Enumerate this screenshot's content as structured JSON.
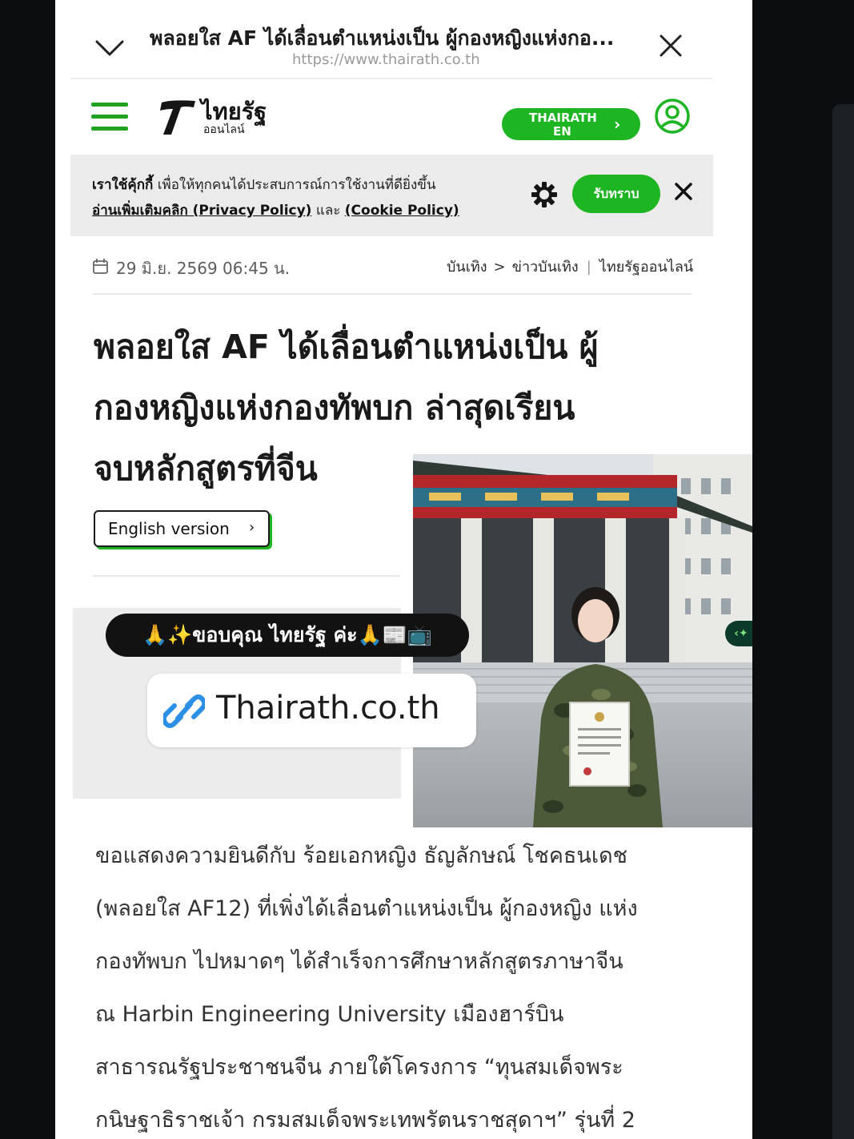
{
  "browser": {
    "tab_title": "พลอยใส AF ได้เลื่อนตำแหน่งเป็น ผู้กองหญิงแห่งกอ...",
    "url": "https://www.thairath.co.th"
  },
  "site_header": {
    "logo_name": "ไทยรัฐ",
    "logo_sub": "ออนไลน์",
    "en_button_line1": "THAIRATH",
    "en_button_line2": "EN",
    "en_button_arrow": "›"
  },
  "cookie_banner": {
    "bold_text": "เราใช้คุ้กกี้",
    "text": " เพื่อให้ทุกคนได้ประสบการณ์การใช้งานที่ดียิ่งขึ้น",
    "more_link": "อ่านเพิ่มเติมคลิก (Privacy Policy)",
    "and": " และ ",
    "cookie_link": "(Cookie Policy)",
    "accept_label": "รับทราบ"
  },
  "meta": {
    "date": "29 มิ.ย. 2569 06:45 น.",
    "breadcrumb": [
      "บันเทิง",
      "ข่าวบันเทิง"
    ],
    "breadcrumb_sep": ">",
    "source": "ไทยรัฐออนไลน์"
  },
  "article": {
    "headline_lines": [
      "พลอยใส AF ได้เลื่อนตำแหน่งเป็น ผู้",
      "กองหญิงแห่งกองทัพบก ล่าสุดเรียน",
      "จบหลักสูตรที่จีน"
    ],
    "english_version_label": "English version",
    "english_version_arrow": "›",
    "body_lines": [
      "ขอแสดงความยินดีกับ ร้อยเอกหญิง ธัญลักษณ์ โชคธนเดช",
      "(พลอยใส AF12) ที่เพิ่งได้เลื่อนตำแหน่งเป็น ผู้กองหญิง แห่ง",
      "กองทัพบก ไปหมาดๆ ได้สำเร็จการศึกษาหลักสูตรภาษาจีน",
      "ณ Harbin Engineering University เมืองฮาร์บิน",
      "สาธารณรัฐประชาชนจีน ภายใต้โครงการ “ทุนสมเด็จพระ",
      "กนิษฐาธิราชเจ้า กรมสมเด็จพระเทพรัตนราชสุดาฯ” รุ่นที่ 2"
    ]
  },
  "story_overlay": {
    "caption": "🙏✨ขอบคุณ ไทยรัฐ ค่ะ🙏📰📺",
    "link_text": "Thairath.co.th"
  },
  "side_button_label": "‹✦",
  "colors": {
    "brand_green": "#1eb523",
    "background": "#0b0d0f"
  }
}
